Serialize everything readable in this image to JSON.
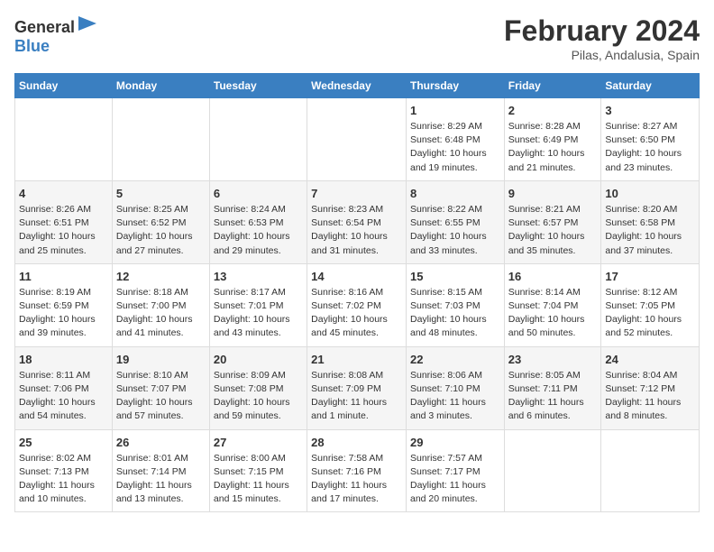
{
  "header": {
    "logo_general": "General",
    "logo_blue": "Blue",
    "main_title": "February 2024",
    "sub_title": "Pilas, Andalusia, Spain"
  },
  "weekdays": [
    "Sunday",
    "Monday",
    "Tuesday",
    "Wednesday",
    "Thursday",
    "Friday",
    "Saturday"
  ],
  "weeks": [
    [
      {
        "day": "",
        "info": ""
      },
      {
        "day": "",
        "info": ""
      },
      {
        "day": "",
        "info": ""
      },
      {
        "day": "",
        "info": ""
      },
      {
        "day": "1",
        "info": "Sunrise: 8:29 AM\nSunset: 6:48 PM\nDaylight: 10 hours\nand 19 minutes."
      },
      {
        "day": "2",
        "info": "Sunrise: 8:28 AM\nSunset: 6:49 PM\nDaylight: 10 hours\nand 21 minutes."
      },
      {
        "day": "3",
        "info": "Sunrise: 8:27 AM\nSunset: 6:50 PM\nDaylight: 10 hours\nand 23 minutes."
      }
    ],
    [
      {
        "day": "4",
        "info": "Sunrise: 8:26 AM\nSunset: 6:51 PM\nDaylight: 10 hours\nand 25 minutes."
      },
      {
        "day": "5",
        "info": "Sunrise: 8:25 AM\nSunset: 6:52 PM\nDaylight: 10 hours\nand 27 minutes."
      },
      {
        "day": "6",
        "info": "Sunrise: 8:24 AM\nSunset: 6:53 PM\nDaylight: 10 hours\nand 29 minutes."
      },
      {
        "day": "7",
        "info": "Sunrise: 8:23 AM\nSunset: 6:54 PM\nDaylight: 10 hours\nand 31 minutes."
      },
      {
        "day": "8",
        "info": "Sunrise: 8:22 AM\nSunset: 6:55 PM\nDaylight: 10 hours\nand 33 minutes."
      },
      {
        "day": "9",
        "info": "Sunrise: 8:21 AM\nSunset: 6:57 PM\nDaylight: 10 hours\nand 35 minutes."
      },
      {
        "day": "10",
        "info": "Sunrise: 8:20 AM\nSunset: 6:58 PM\nDaylight: 10 hours\nand 37 minutes."
      }
    ],
    [
      {
        "day": "11",
        "info": "Sunrise: 8:19 AM\nSunset: 6:59 PM\nDaylight: 10 hours\nand 39 minutes."
      },
      {
        "day": "12",
        "info": "Sunrise: 8:18 AM\nSunset: 7:00 PM\nDaylight: 10 hours\nand 41 minutes."
      },
      {
        "day": "13",
        "info": "Sunrise: 8:17 AM\nSunset: 7:01 PM\nDaylight: 10 hours\nand 43 minutes."
      },
      {
        "day": "14",
        "info": "Sunrise: 8:16 AM\nSunset: 7:02 PM\nDaylight: 10 hours\nand 45 minutes."
      },
      {
        "day": "15",
        "info": "Sunrise: 8:15 AM\nSunset: 7:03 PM\nDaylight: 10 hours\nand 48 minutes."
      },
      {
        "day": "16",
        "info": "Sunrise: 8:14 AM\nSunset: 7:04 PM\nDaylight: 10 hours\nand 50 minutes."
      },
      {
        "day": "17",
        "info": "Sunrise: 8:12 AM\nSunset: 7:05 PM\nDaylight: 10 hours\nand 52 minutes."
      }
    ],
    [
      {
        "day": "18",
        "info": "Sunrise: 8:11 AM\nSunset: 7:06 PM\nDaylight: 10 hours\nand 54 minutes."
      },
      {
        "day": "19",
        "info": "Sunrise: 8:10 AM\nSunset: 7:07 PM\nDaylight: 10 hours\nand 57 minutes."
      },
      {
        "day": "20",
        "info": "Sunrise: 8:09 AM\nSunset: 7:08 PM\nDaylight: 10 hours\nand 59 minutes."
      },
      {
        "day": "21",
        "info": "Sunrise: 8:08 AM\nSunset: 7:09 PM\nDaylight: 11 hours\nand 1 minute."
      },
      {
        "day": "22",
        "info": "Sunrise: 8:06 AM\nSunset: 7:10 PM\nDaylight: 11 hours\nand 3 minutes."
      },
      {
        "day": "23",
        "info": "Sunrise: 8:05 AM\nSunset: 7:11 PM\nDaylight: 11 hours\nand 6 minutes."
      },
      {
        "day": "24",
        "info": "Sunrise: 8:04 AM\nSunset: 7:12 PM\nDaylight: 11 hours\nand 8 minutes."
      }
    ],
    [
      {
        "day": "25",
        "info": "Sunrise: 8:02 AM\nSunset: 7:13 PM\nDaylight: 11 hours\nand 10 minutes."
      },
      {
        "day": "26",
        "info": "Sunrise: 8:01 AM\nSunset: 7:14 PM\nDaylight: 11 hours\nand 13 minutes."
      },
      {
        "day": "27",
        "info": "Sunrise: 8:00 AM\nSunset: 7:15 PM\nDaylight: 11 hours\nand 15 minutes."
      },
      {
        "day": "28",
        "info": "Sunrise: 7:58 AM\nSunset: 7:16 PM\nDaylight: 11 hours\nand 17 minutes."
      },
      {
        "day": "29",
        "info": "Sunrise: 7:57 AM\nSunset: 7:17 PM\nDaylight: 11 hours\nand 20 minutes."
      },
      {
        "day": "",
        "info": ""
      },
      {
        "day": "",
        "info": ""
      }
    ]
  ]
}
